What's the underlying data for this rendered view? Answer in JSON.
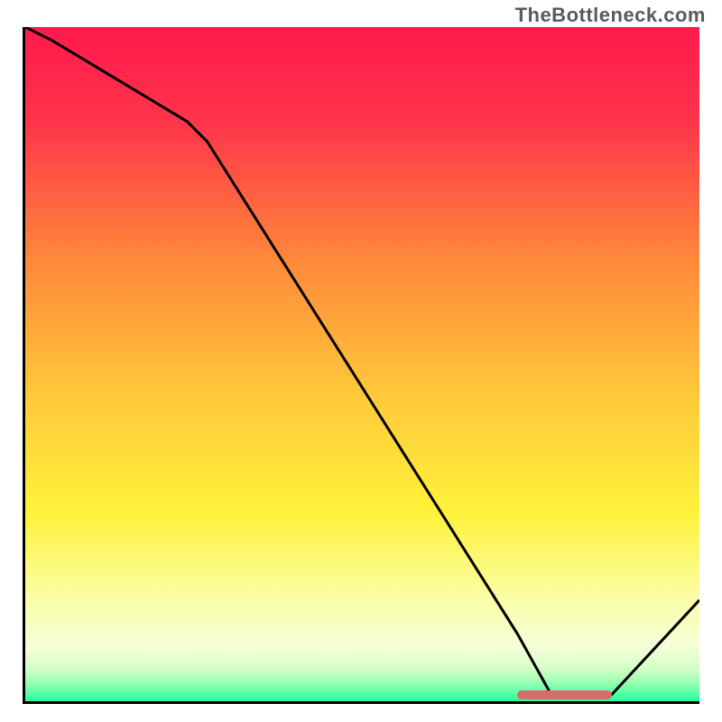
{
  "watermark": "TheBottleneck.com",
  "chart_data": {
    "type": "line",
    "title": "",
    "xlabel": "",
    "ylabel": "",
    "xlim": [
      0,
      100
    ],
    "ylim": [
      0,
      100
    ],
    "x": [
      0,
      4,
      24,
      27,
      73,
      78,
      87,
      100
    ],
    "values": [
      100,
      98,
      86,
      83,
      10,
      1,
      1,
      15
    ],
    "highlight_range_x": [
      73,
      87
    ],
    "gradient_stops": [
      {
        "pos": 0,
        "color": "#ff1a4d"
      },
      {
        "pos": 14,
        "color": "#ff344a"
      },
      {
        "pos": 35,
        "color": "#ff8a3a"
      },
      {
        "pos": 55,
        "color": "#ffc93a"
      },
      {
        "pos": 72,
        "color": "#fff23a"
      },
      {
        "pos": 86,
        "color": "#faffb0"
      },
      {
        "pos": 92,
        "color": "#f4ffd8"
      },
      {
        "pos": 95,
        "color": "#d8ffc8"
      },
      {
        "pos": 97,
        "color": "#a0ffb4"
      },
      {
        "pos": 100,
        "color": "#2aff9d"
      }
    ]
  },
  "colors": {
    "curve": "#000000",
    "marker": "#d86b6b",
    "axis": "#000000"
  }
}
